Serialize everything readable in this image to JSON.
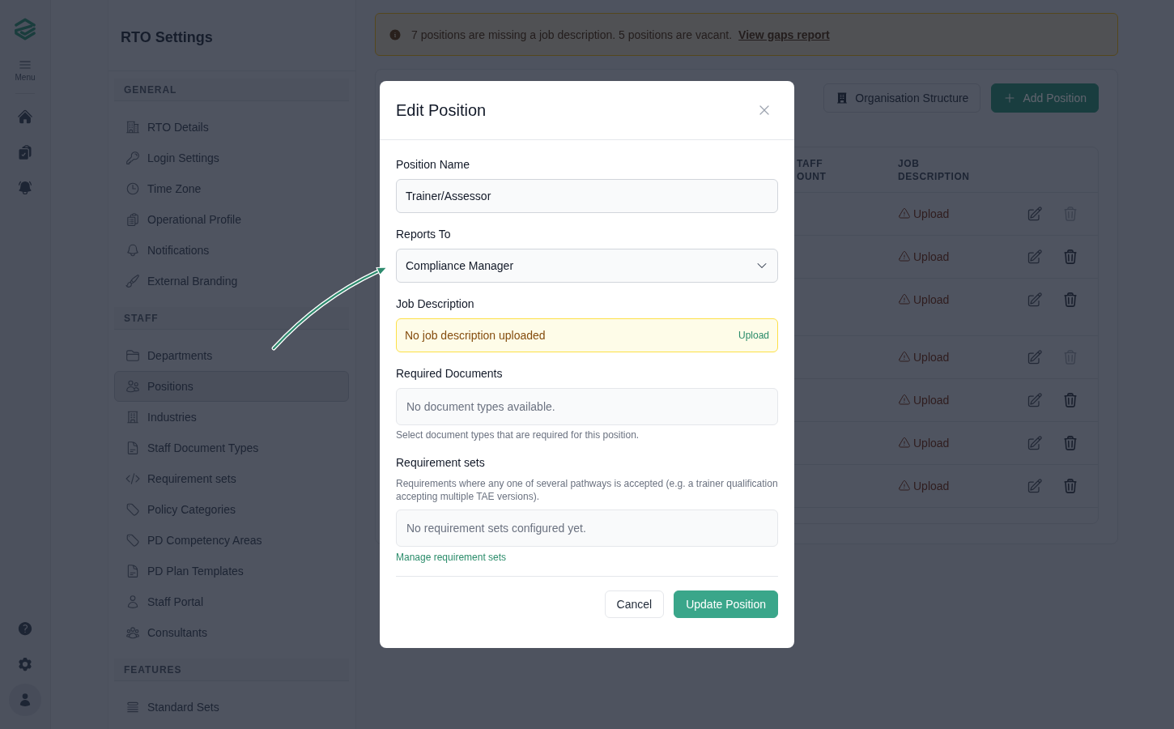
{
  "rail": {
    "menu_label": "Menu"
  },
  "sidebar": {
    "title": "RTO Settings",
    "sections": [
      {
        "heading": "GENERAL",
        "items": [
          {
            "label": "RTO Details",
            "selected": false
          },
          {
            "label": "Login Settings",
            "selected": false
          },
          {
            "label": "Time Zone",
            "selected": false
          },
          {
            "label": "Operational Profile",
            "selected": false
          },
          {
            "label": "Notifications",
            "selected": false
          },
          {
            "label": "External Branding",
            "selected": false
          }
        ]
      },
      {
        "heading": "STAFF",
        "items": [
          {
            "label": "Departments",
            "selected": false
          },
          {
            "label": "Positions",
            "selected": true
          },
          {
            "label": "Industries",
            "selected": false
          },
          {
            "label": "Staff Document Types",
            "selected": false
          },
          {
            "label": "Requirement sets",
            "selected": false
          },
          {
            "label": "Policy Categories",
            "selected": false
          },
          {
            "label": "PD Competency Areas",
            "selected": false
          },
          {
            "label": "PD Plan Templates",
            "selected": false
          },
          {
            "label": "Staff Portal",
            "selected": false
          },
          {
            "label": "Consultants",
            "selected": false
          }
        ]
      },
      {
        "heading": "FEATURES",
        "items": [
          {
            "label": "Standard Sets",
            "selected": false
          }
        ]
      }
    ]
  },
  "banner": {
    "message": "7 positions are missing a job description. 5 positions are vacant.",
    "link": "View gaps report"
  },
  "toolbar": {
    "buttons": [
      {
        "label": "Organisation Structure",
        "kind": "secondary"
      },
      {
        "label": "Add Position",
        "kind": "primary"
      }
    ]
  },
  "table": {
    "columns": [
      "TAFF OUNT",
      "JOB DESCRIPTION"
    ],
    "rows": [
      {
        "job_description": "Upload",
        "delete_disabled": true
      },
      {
        "job_description": "Upload",
        "delete_disabled": false
      },
      {
        "job_description": "Upload",
        "delete_disabled": false
      },
      {
        "job_description": "Upload",
        "delete_disabled": true
      },
      {
        "job_description": "Upload",
        "delete_disabled": false
      },
      {
        "job_description": "Upload",
        "delete_disabled": false
      },
      {
        "job_description": "Upload",
        "delete_disabled": false
      }
    ]
  },
  "modal": {
    "title": "Edit Position",
    "position_name": {
      "label": "Position Name",
      "value": "Trainer/Assessor"
    },
    "reports_to": {
      "label": "Reports To",
      "value": "Compliance Manager"
    },
    "job_description": {
      "label": "Job Description",
      "status": "No job description uploaded",
      "action": "Upload"
    },
    "required_documents": {
      "label": "Required Documents",
      "empty_text": "No document types available.",
      "help": "Select document types that are required for this position."
    },
    "requirement_sets": {
      "label": "Requirement sets",
      "description": "Requirements where any one of several pathways is accepted (e.g. a trainer qualification accepting multiple TAE versions).",
      "empty_text": "No requirement sets configured yet.",
      "link": "Manage requirement sets"
    },
    "buttons": [
      {
        "label": "Cancel",
        "kind": "secondary"
      },
      {
        "label": "Update Position",
        "kind": "primary"
      }
    ]
  }
}
